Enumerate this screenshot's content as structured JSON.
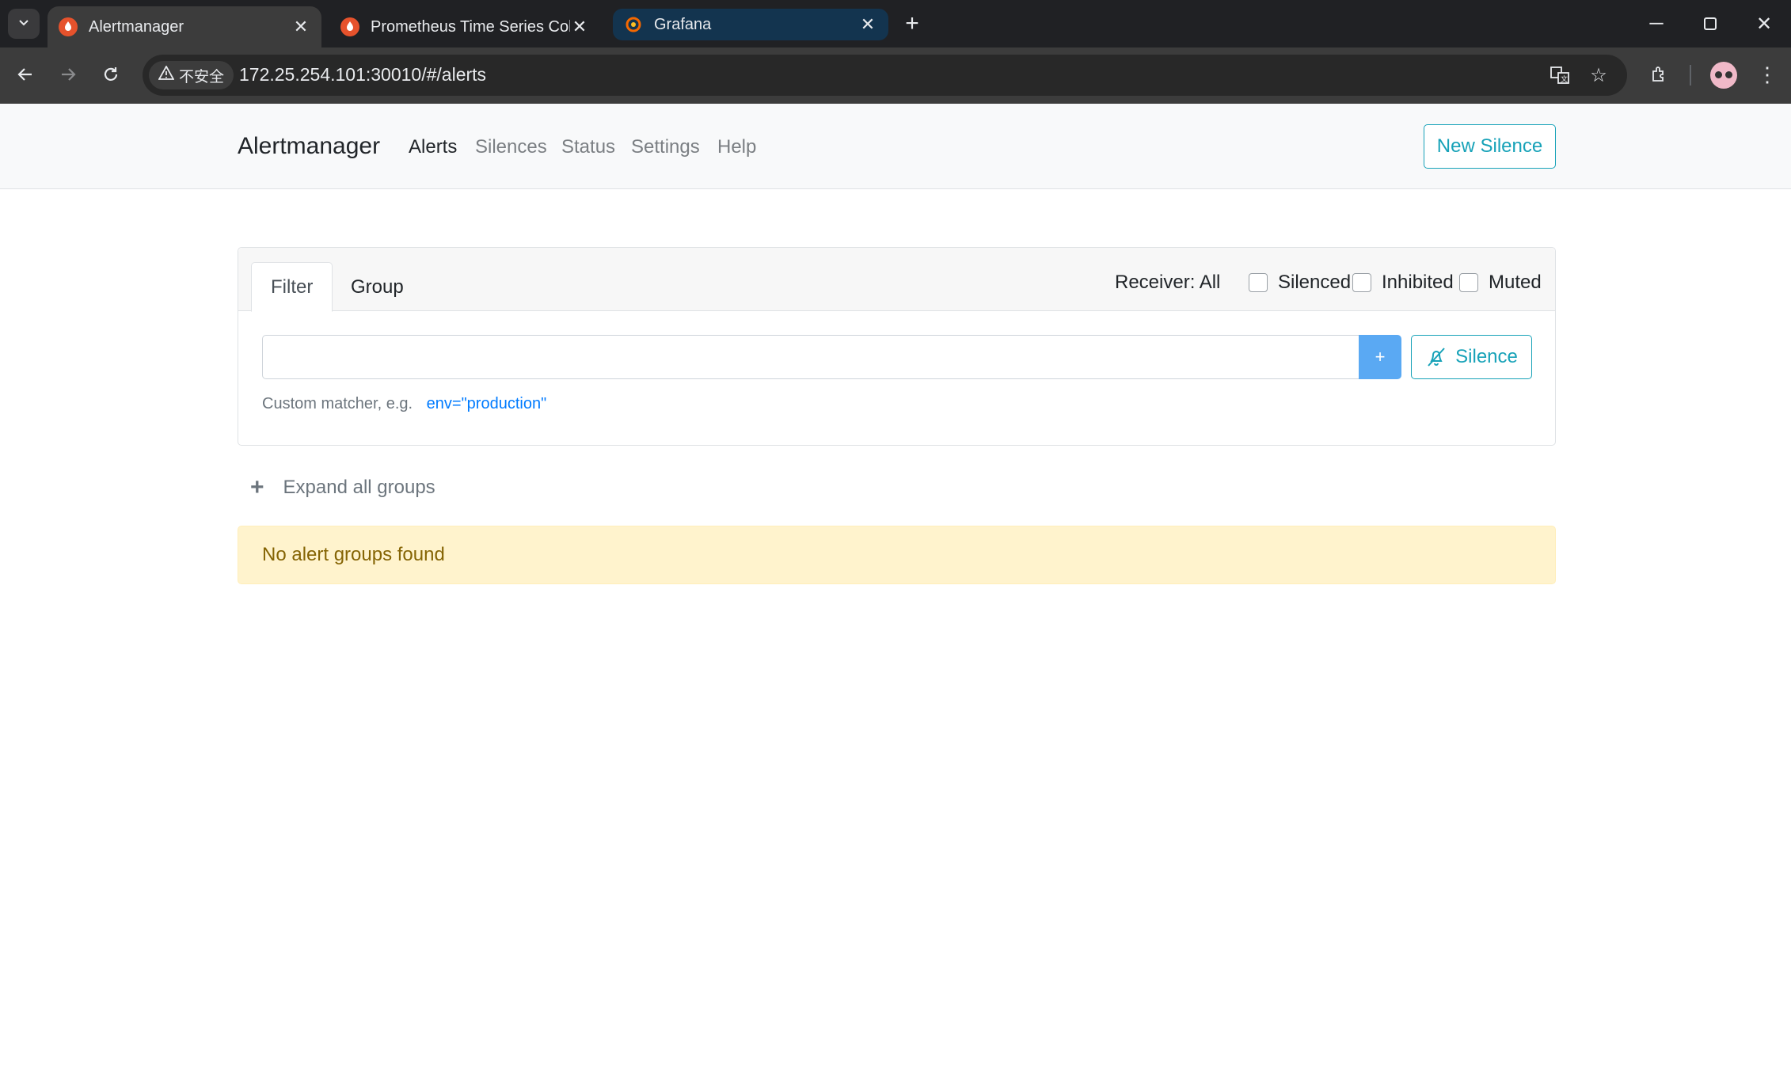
{
  "browser": {
    "tabs": [
      {
        "title": "Alertmanager",
        "icon": "prometheus-icon",
        "active": true
      },
      {
        "title": "Prometheus Time Series Coll",
        "icon": "prometheus-icon",
        "active": false
      },
      {
        "title": "Grafana",
        "icon": "grafana-icon",
        "active": false
      }
    ],
    "security_label": "不安全",
    "url": "172.25.254.101:30010/#/alerts"
  },
  "navbar": {
    "brand": "Alertmanager",
    "links": [
      "Alerts",
      "Silences",
      "Status",
      "Settings",
      "Help"
    ],
    "active_link": "Alerts",
    "new_silence_label": "New Silence"
  },
  "filter_card": {
    "tabs": [
      "Filter",
      "Group"
    ],
    "active_tab": "Filter",
    "receiver_label": "Receiver: All",
    "checkboxes": [
      {
        "label": "Silenced",
        "checked": false
      },
      {
        "label": "Inhibited",
        "checked": false
      },
      {
        "label": "Muted",
        "checked": false
      }
    ],
    "input_value": "",
    "add_button": "+",
    "silence_button": "Silence",
    "hint_text": "Custom matcher, e.g.",
    "hint_example": "env=\"production\""
  },
  "expand_label": "Expand all groups",
  "empty_message": "No alert groups found",
  "colors": {
    "accent": "#17a2b8",
    "primary": "#007bff",
    "warning_bg": "#fff3cd",
    "warning_text": "#856404"
  }
}
